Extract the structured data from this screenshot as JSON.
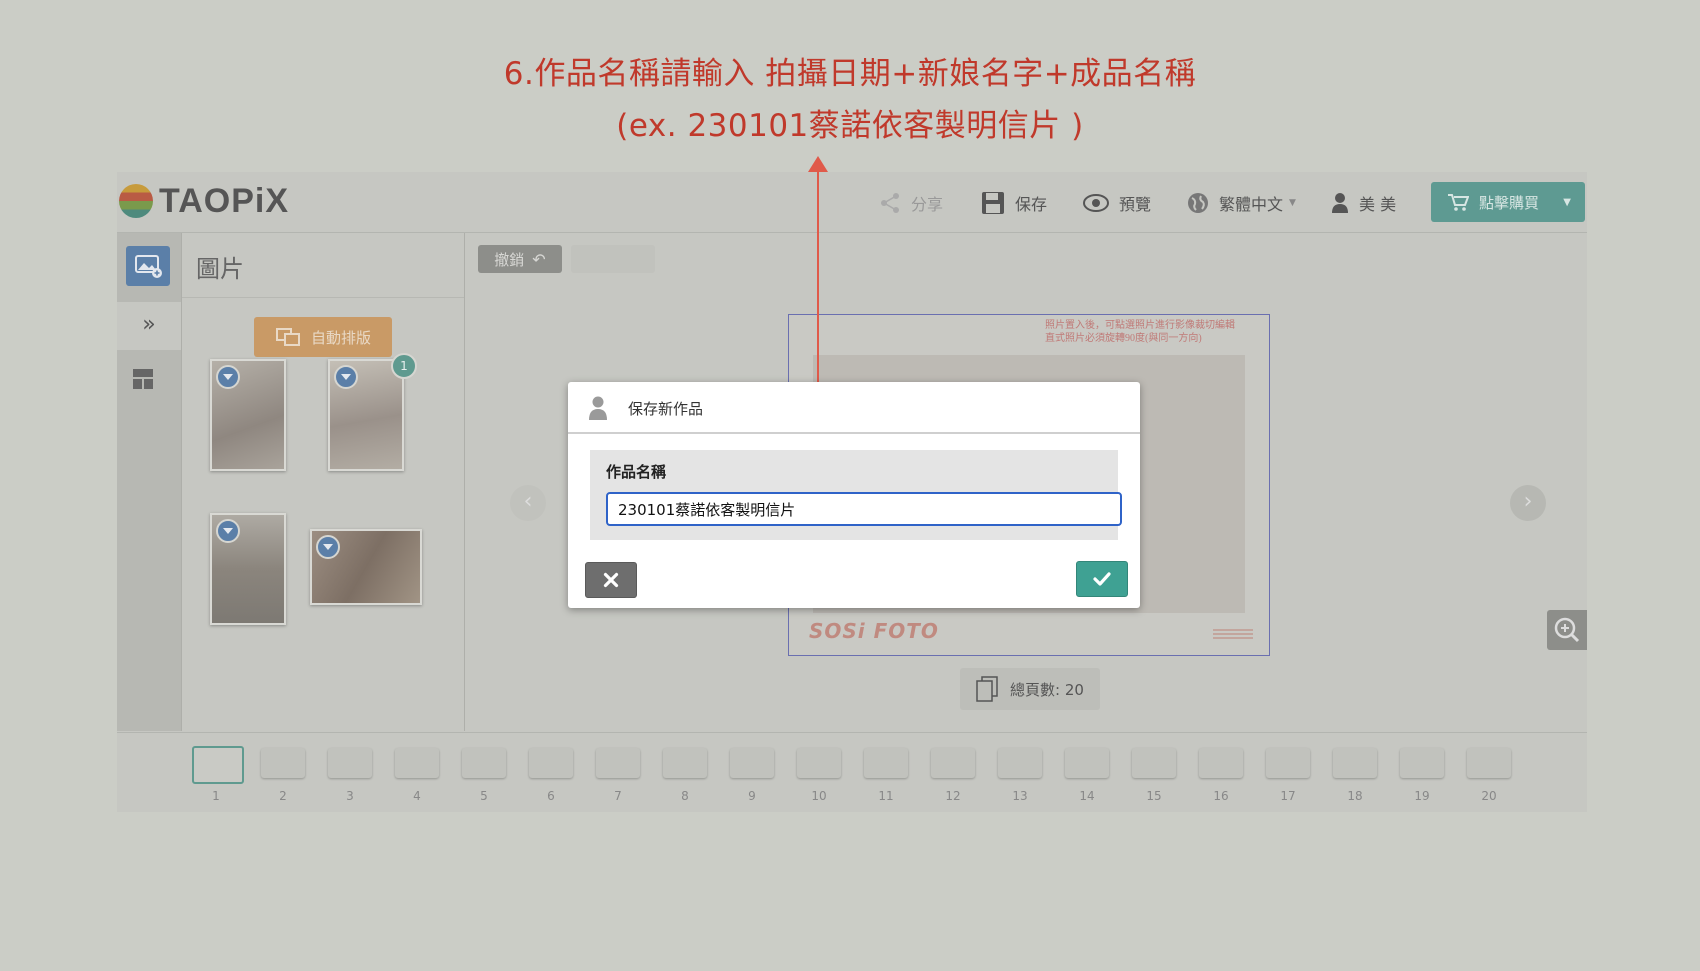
{
  "instruction": {
    "line1": "6.作品名稱請輸入 拍攝日期+新娘名字+成品名稱",
    "line2": "(ex. 230101蔡諾依客製明信片 )",
    "color": "#c0392b"
  },
  "header": {
    "logo": "TAOPiX",
    "share_label": "分享",
    "save_label": "保存",
    "preview_label": "預覽",
    "language_label": "繁體中文",
    "user_label": "美 美",
    "buy_label": "點擊購買"
  },
  "sidebar": {
    "panel_title": "圖片",
    "auto_layout_label": "自動排版",
    "photo_count_badge": "1"
  },
  "toolbar": {
    "undo_label": "撤銷"
  },
  "page": {
    "note_line1": "照片置入後，可點選照片進行影像裁切編輯",
    "note_line2": "直式照片必須旋轉90度(與同一方向)",
    "brand": "SOSi FOTO",
    "total_pages_label": "總頁數: 20"
  },
  "pages": [
    "1",
    "2",
    "3",
    "4",
    "5",
    "6",
    "7",
    "8",
    "9",
    "10",
    "11",
    "12",
    "13",
    "14",
    "15",
    "16",
    "17",
    "18",
    "19",
    "20"
  ],
  "dialog": {
    "title": "保存新作品",
    "field_label": "作品名稱",
    "name_value": "230101蔡諾依客製明信片"
  },
  "colors": {
    "accent_teal": "#3fa193",
    "input_border": "#2f63c8",
    "buy_button": "#5e9a92",
    "auto_layout": "#c99a66"
  },
  "icons": {
    "share": "share-icon",
    "save": "floppy-disk-icon",
    "preview": "eye-icon",
    "language": "globe-icon",
    "user": "user-icon",
    "cart": "cart-icon",
    "cancel": "close-icon",
    "confirm": "check-icon",
    "zoom": "zoom-in-icon"
  }
}
